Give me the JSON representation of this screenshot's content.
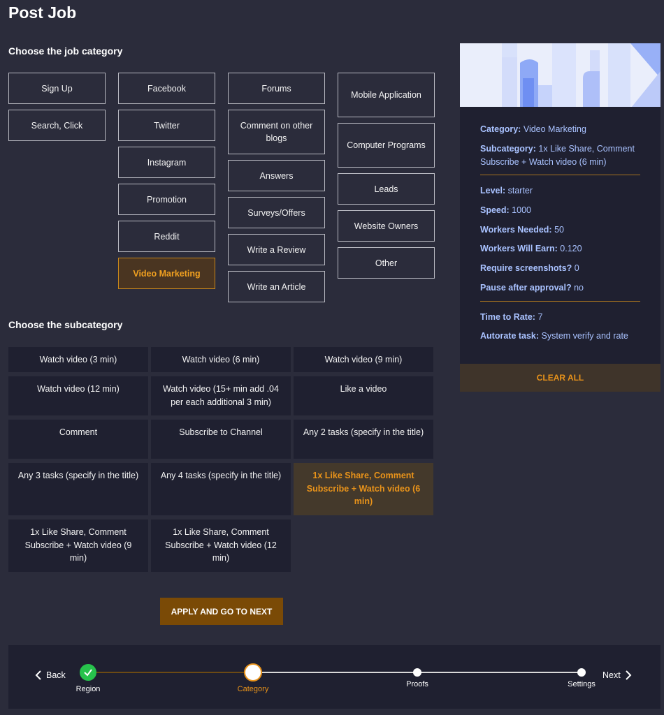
{
  "page": {
    "title": "Post Job"
  },
  "category_section": {
    "title": "Choose the job category"
  },
  "categories": {
    "col1": [
      "Sign Up",
      "Search, Click"
    ],
    "col2": [
      "Facebook",
      "Twitter",
      "Instagram",
      "Promotion",
      "Reddit",
      "Video Marketing"
    ],
    "col3": [
      "Forums",
      "Comment on other blogs",
      "Answers",
      "Surveys/Offers",
      "Write a Review",
      "Write an Article"
    ],
    "col4": [
      "Mobile Application",
      "Computer Programs",
      "Leads",
      "Website Owners",
      "Other"
    ],
    "selected": "Video Marketing"
  },
  "subcategory_section": {
    "title": "Choose the subcategory"
  },
  "subcategories": [
    [
      "Watch video (3 min)",
      "Watch video (6 min)",
      "Watch video (9 min)"
    ],
    [
      "Watch video (12 min)",
      "Watch video (15+ min add .04 per each additional 3 min)",
      "Like a video"
    ],
    [
      "Comment",
      "Subscribe to Channel",
      "Any 2 tasks (specify in the title)"
    ],
    [
      "Any 3 tasks (specify in the title)",
      "Any 4 tasks (specify in the title)",
      "1x Like Share, Comment Subscribe + Watch video (6 min)"
    ],
    [
      "1x Like Share, Comment Subscribe + Watch video (9 min)",
      "1x Like Share, Comment Subscribe + Watch video (12 min)"
    ]
  ],
  "apply_button": "APPLY AND GO TO NEXT",
  "summary": {
    "category": {
      "label": "Category:",
      "value": "Video Marketing"
    },
    "subcategory": {
      "label": "Subcategory:",
      "value": "1x Like Share, Comment Subscribe + Watch video (6 min)"
    },
    "level": {
      "label": "Level:",
      "value": "starter"
    },
    "speed": {
      "label": "Speed:",
      "value": "1000"
    },
    "workers_needed": {
      "label": "Workers Needed:",
      "value": "50"
    },
    "workers_earn": {
      "label": "Workers Will Earn:",
      "value": "0.120"
    },
    "screenshots": {
      "label": "Require screenshots?",
      "value": "0"
    },
    "pause": {
      "label": "Pause after approval?",
      "value": "no"
    },
    "time_to_rate": {
      "label": "Time to Rate:",
      "value": "7"
    },
    "autorate": {
      "label": "Autorate task:",
      "value": "System verify and rate"
    },
    "clear_button": "CLEAR ALL"
  },
  "stepper": {
    "back": "Back",
    "next": "Next",
    "steps": [
      "Region",
      "Category",
      "Proofs",
      "Settings"
    ],
    "current_step": "Category",
    "completed_steps": [
      "Region"
    ]
  },
  "colors": {
    "background": "#2b2c3b",
    "panel": "#1f2030",
    "accent": "#e9931a",
    "active_category_border": "#c8871b",
    "info_text": "#a9c2ff",
    "completed_step": "#27c24c"
  }
}
